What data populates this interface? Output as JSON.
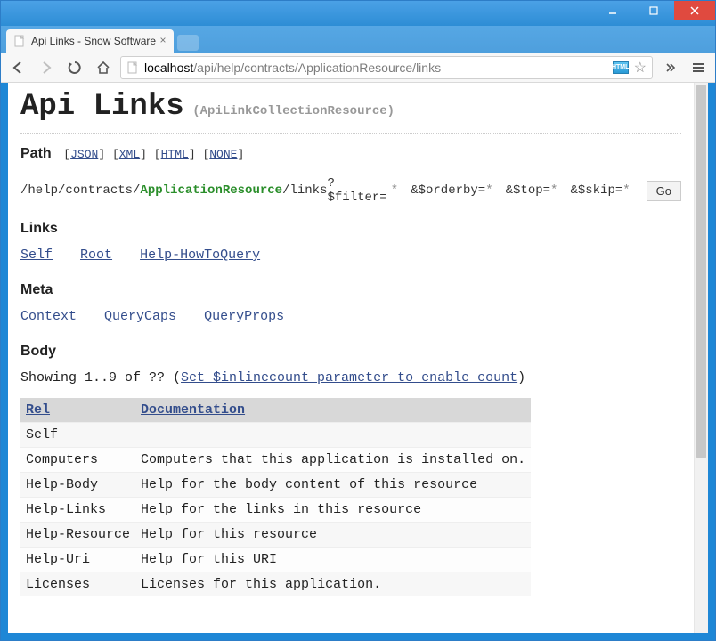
{
  "window": {
    "tab_title": "Api Links - Snow Software"
  },
  "omnibox": {
    "host": "localhost",
    "path": "/api/help/contracts/ApplicationResource/links"
  },
  "page": {
    "title": "Api Links",
    "subtitle": "(ApiLinkCollectionResource)"
  },
  "path": {
    "heading": "Path",
    "formats": [
      "JSON",
      "XML",
      "HTML",
      "NONE"
    ],
    "segments": [
      "/help",
      "/contracts/",
      "ApplicationResource",
      "/links"
    ],
    "query_parts": [
      "?$filter=",
      "&$orderby=",
      "&$top=",
      "&$skip="
    ],
    "placeholder": "*",
    "go_label": "Go"
  },
  "links": {
    "heading": "Links",
    "items": [
      "Self",
      "Root",
      "Help-HowToQuery"
    ]
  },
  "meta": {
    "heading": "Meta",
    "items": [
      "Context",
      "QueryCaps",
      "QueryProps"
    ]
  },
  "body": {
    "heading": "Body",
    "showing_prefix": "Showing 1..9 of ?? (",
    "inline_link": "Set $inlinecount parameter to enable count",
    "showing_suffix": ")",
    "columns": [
      "Rel",
      "Documentation"
    ],
    "rows": [
      {
        "rel": "Self",
        "doc": ""
      },
      {
        "rel": "Computers",
        "doc": "Computers that this application is installed on."
      },
      {
        "rel": "Help-Body",
        "doc": "Help for the body content of this resource"
      },
      {
        "rel": "Help-Links",
        "doc": "Help for the links in this resource"
      },
      {
        "rel": "Help-Resource",
        "doc": "Help for this resource"
      },
      {
        "rel": "Help-Uri",
        "doc": "Help for this URI"
      },
      {
        "rel": "Licenses",
        "doc": "Licenses for this application."
      }
    ]
  }
}
